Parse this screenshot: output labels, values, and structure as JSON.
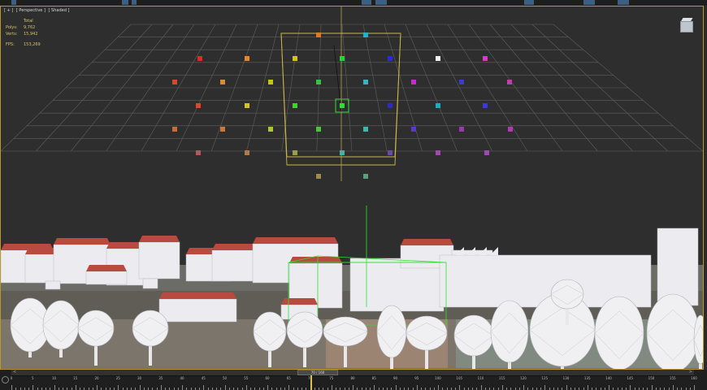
{
  "viewport": {
    "label_parts": [
      "[ + ]",
      "[ Perspective ]",
      "[ Shaded ]"
    ],
    "stats": {
      "header": "Total",
      "polys_label": "Polys:",
      "polys_value": "9,762",
      "verts_label": "Verts:",
      "verts_value": "15,942",
      "fps_label": "FPS:",
      "fps_value": "153,269"
    }
  },
  "timeline": {
    "frame_counter": "70 / 160",
    "current_frame": 70,
    "max_frame": 160,
    "tick_labels": [
      "0",
      "5",
      "10",
      "15",
      "20",
      "25",
      "30",
      "35",
      "40",
      "45",
      "50",
      "55",
      "60",
      "65",
      "70",
      "75",
      "80",
      "85",
      "90",
      "95",
      "100",
      "105",
      "110",
      "115",
      "120",
      "125",
      "130",
      "135",
      "140",
      "145",
      "150",
      "155",
      "160"
    ]
  },
  "scene_colors": {
    "accent_selection": "#b89a2c",
    "grid": "#5f5f5f",
    "bbox": "#c9b64a",
    "green_select": "#33dd33",
    "roof": "#b94a3f",
    "sky": "#2e2e2e"
  }
}
